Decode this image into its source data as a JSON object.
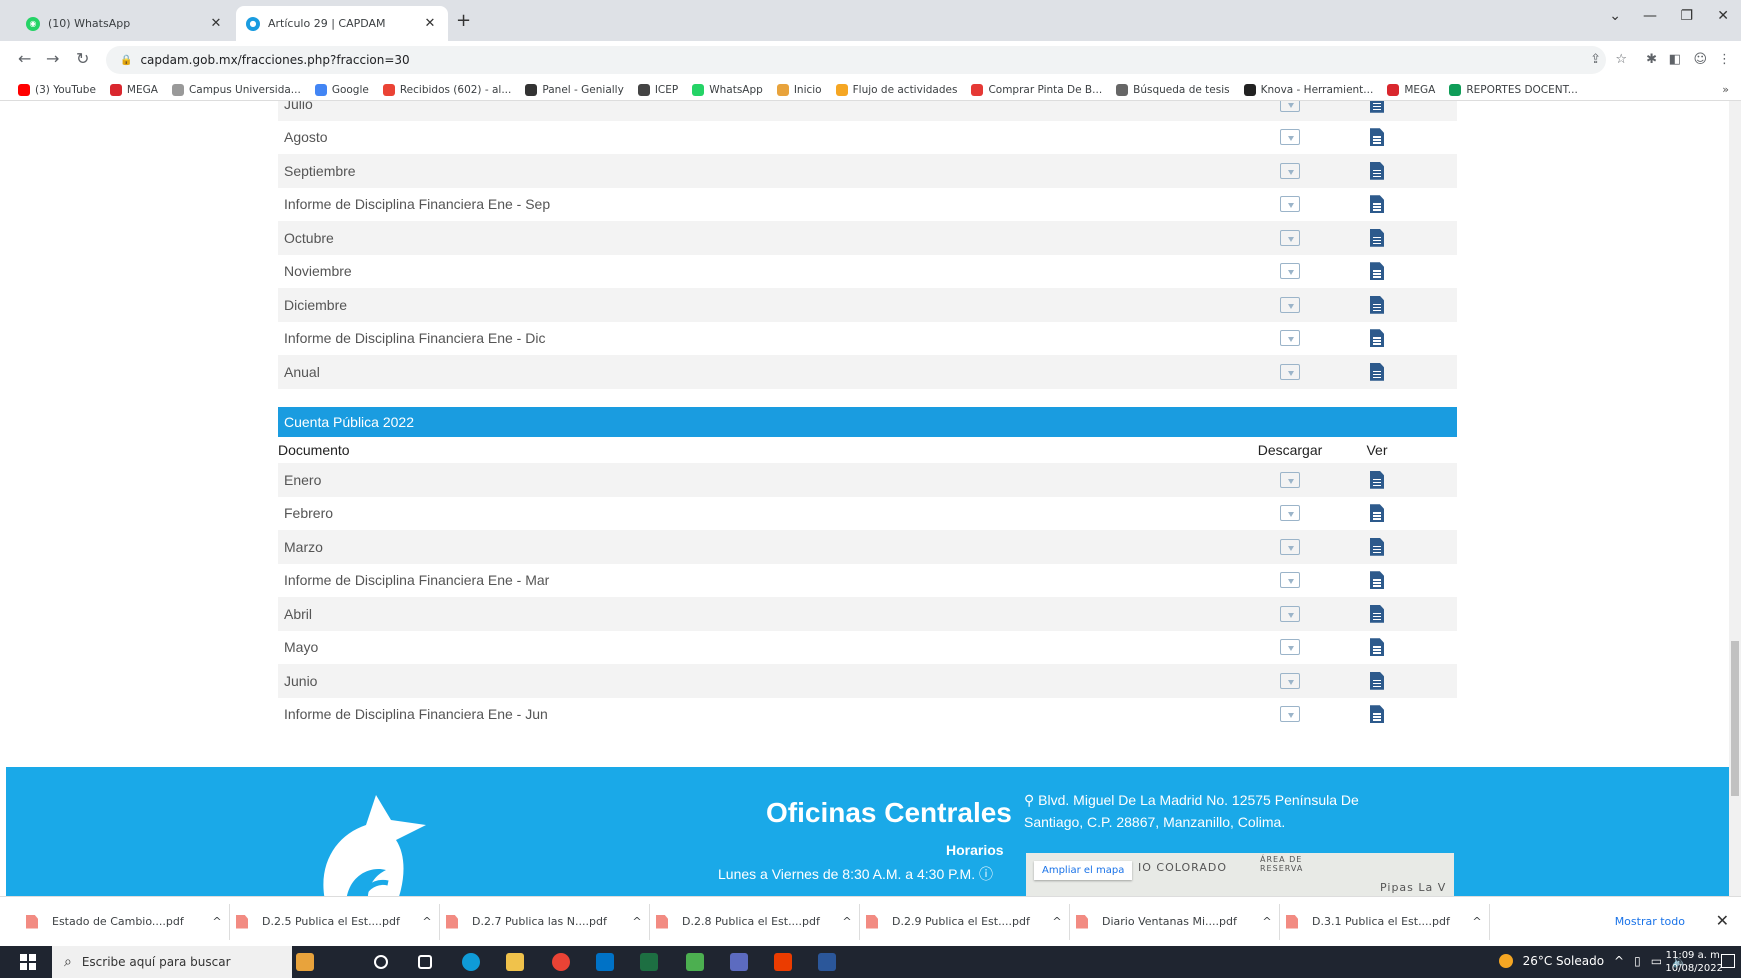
{
  "browser": {
    "tabs": [
      {
        "title": "(10) WhatsApp",
        "badge": "10",
        "color": "#25d366"
      },
      {
        "title": "Artículo 29 | CAPDAM",
        "color": "#1a9ce0"
      }
    ],
    "url": "capdam.gob.mx/fracciones.php?fraccion=30",
    "bookmarks": [
      {
        "label": "(3) YouTube",
        "color": "#ff0000"
      },
      {
        "label": "MEGA",
        "color": "#d9272e"
      },
      {
        "label": "Campus Universida...",
        "color": "#999999"
      },
      {
        "label": "Google",
        "color": "#4285f4"
      },
      {
        "label": "Recibidos (602) - al...",
        "color": "#ea4335"
      },
      {
        "label": "Panel - Genially",
        "color": "#333333"
      },
      {
        "label": "ICEP",
        "color": "#444444"
      },
      {
        "label": "WhatsApp",
        "color": "#25d366"
      },
      {
        "label": "Inicio",
        "color": "#e8a33c"
      },
      {
        "label": "Flujo de actividades",
        "color": "#f5a623"
      },
      {
        "label": "Comprar Pinta De B...",
        "color": "#e53935"
      },
      {
        "label": "Búsqueda de tesis",
        "color": "#666666"
      },
      {
        "label": "Knova - Herramient...",
        "color": "#222222"
      },
      {
        "label": "MEGA",
        "color": "#d9272e"
      },
      {
        "label": "REPORTES DOCENT...",
        "color": "#0f9d58"
      }
    ]
  },
  "table_prev": {
    "rows": [
      "Julio",
      "Agosto",
      "Septiembre",
      "Informe de Disciplina Financiera Ene - Sep",
      "Octubre",
      "Noviembre",
      "Diciembre",
      "Informe de Disciplina Financiera Ene - Dic",
      "Anual"
    ]
  },
  "section_2022": {
    "title": "Cuenta Pública 2022",
    "col_doc": "Documento",
    "col_dl": "Descargar",
    "col_view": "Ver",
    "rows": [
      "Enero",
      "Febrero",
      "Marzo",
      "Informe de Disciplina Financiera Ene - Mar",
      "Abril",
      "Mayo",
      "Junio",
      "Informe de Disciplina Financiera Ene - Jun"
    ]
  },
  "footer": {
    "title": "Oficinas Centrales",
    "address": "Blvd. Miguel De La Madrid No. 12575 Península De Santiago, C.P. 28867, Manzanillo, Colima.",
    "hours_label": "Horarios",
    "hours": "Lunes a Viernes de 8:30 A.M. a 4:30 P.M.",
    "map_button": "Ampliar el mapa",
    "map_label1": "IO COLORADO",
    "map_label2": "ÁREA DE RESERVA",
    "map_label3": "Pipas La V"
  },
  "downloads": {
    "items": [
      "Estado de Cambio....pdf",
      "D.2.5 Publica el Est....pdf",
      "D.2.7 Publica las N....pdf",
      "D.2.8 Publica el Est....pdf",
      "D.2.9 Publica el Est....pdf",
      "Diario Ventanas Mi....pdf",
      "D.3.1 Publica el Est....pdf"
    ],
    "show_all": "Mostrar todo"
  },
  "taskbar": {
    "search_placeholder": "Escribe aquí para buscar",
    "weather": "26°C Soleado",
    "time": "11:09 a. m.",
    "date": "10/08/2022"
  }
}
